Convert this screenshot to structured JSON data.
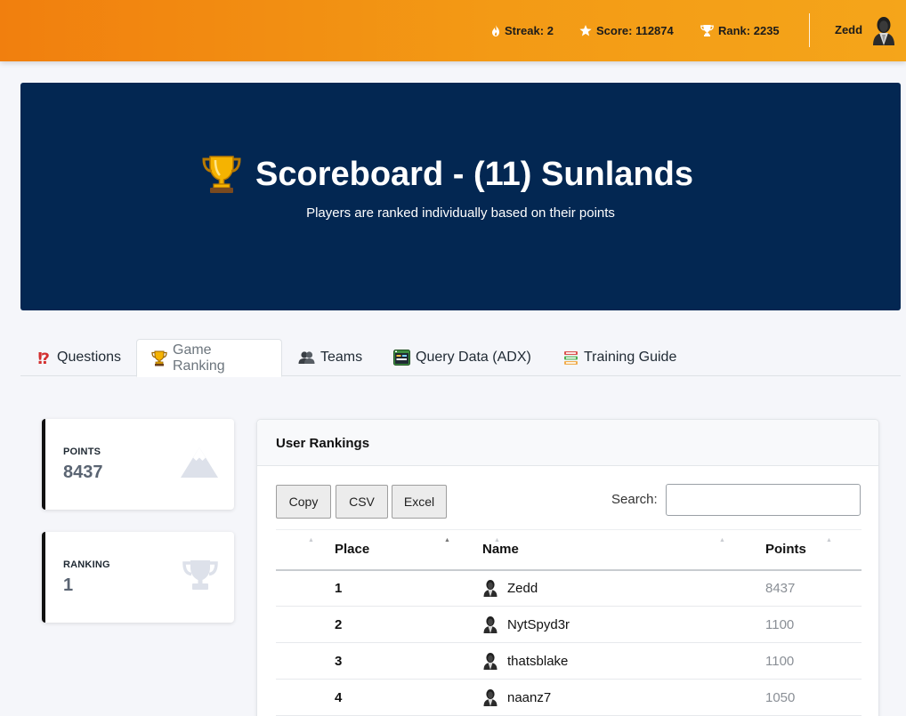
{
  "topbar": {
    "streak_label": "Streak: 2",
    "score_label": "Score: 112874",
    "rank_label": "Rank: 2235",
    "user_name": "Zedd",
    "icons": [
      "flame-icon",
      "star-icon",
      "trophy-icon",
      "avatar"
    ]
  },
  "hero": {
    "title": "Scoreboard - (11) Sunlands",
    "subtitle": "Players are ranked individually based on their points",
    "background": "#032752"
  },
  "tabs": [
    {
      "label": "Questions",
      "icon": "question-exclamation-icon",
      "active": false
    },
    {
      "label": "Game Ranking",
      "icon": "trophy-icon",
      "active": true
    },
    {
      "label": "Teams",
      "icon": "people-icon",
      "active": false
    },
    {
      "label": "Query Data (ADX)",
      "icon": "database-window-icon",
      "active": false
    },
    {
      "label": "Training Guide",
      "icon": "books-icon",
      "active": false
    }
  ],
  "cards": {
    "points": {
      "label": "POINTS",
      "value": "8437",
      "icon": "mountain-icon"
    },
    "ranking": {
      "label": "RANKING",
      "value": "1",
      "icon": "trophy-icon"
    }
  },
  "rankings": {
    "title": "User Rankings",
    "buttons": {
      "copy": "Copy",
      "csv": "CSV",
      "excel": "Excel"
    },
    "search": {
      "label": "Search:",
      "value": "",
      "placeholder": ""
    },
    "columns": {
      "place": "Place",
      "name": "Name",
      "points": "Points"
    },
    "rows": [
      {
        "place": "1",
        "name": "Zedd",
        "points": "8437"
      },
      {
        "place": "2",
        "name": "NytSpyd3r",
        "points": "1100"
      },
      {
        "place": "3",
        "name": "thatsblake",
        "points": "1100"
      },
      {
        "place": "4",
        "name": "naanz7",
        "points": "1050"
      }
    ]
  },
  "colors": {
    "topbar_start": "#f17f0e",
    "topbar_end": "#f5a51a",
    "hero": "#032752",
    "card_accent": "#111111"
  }
}
